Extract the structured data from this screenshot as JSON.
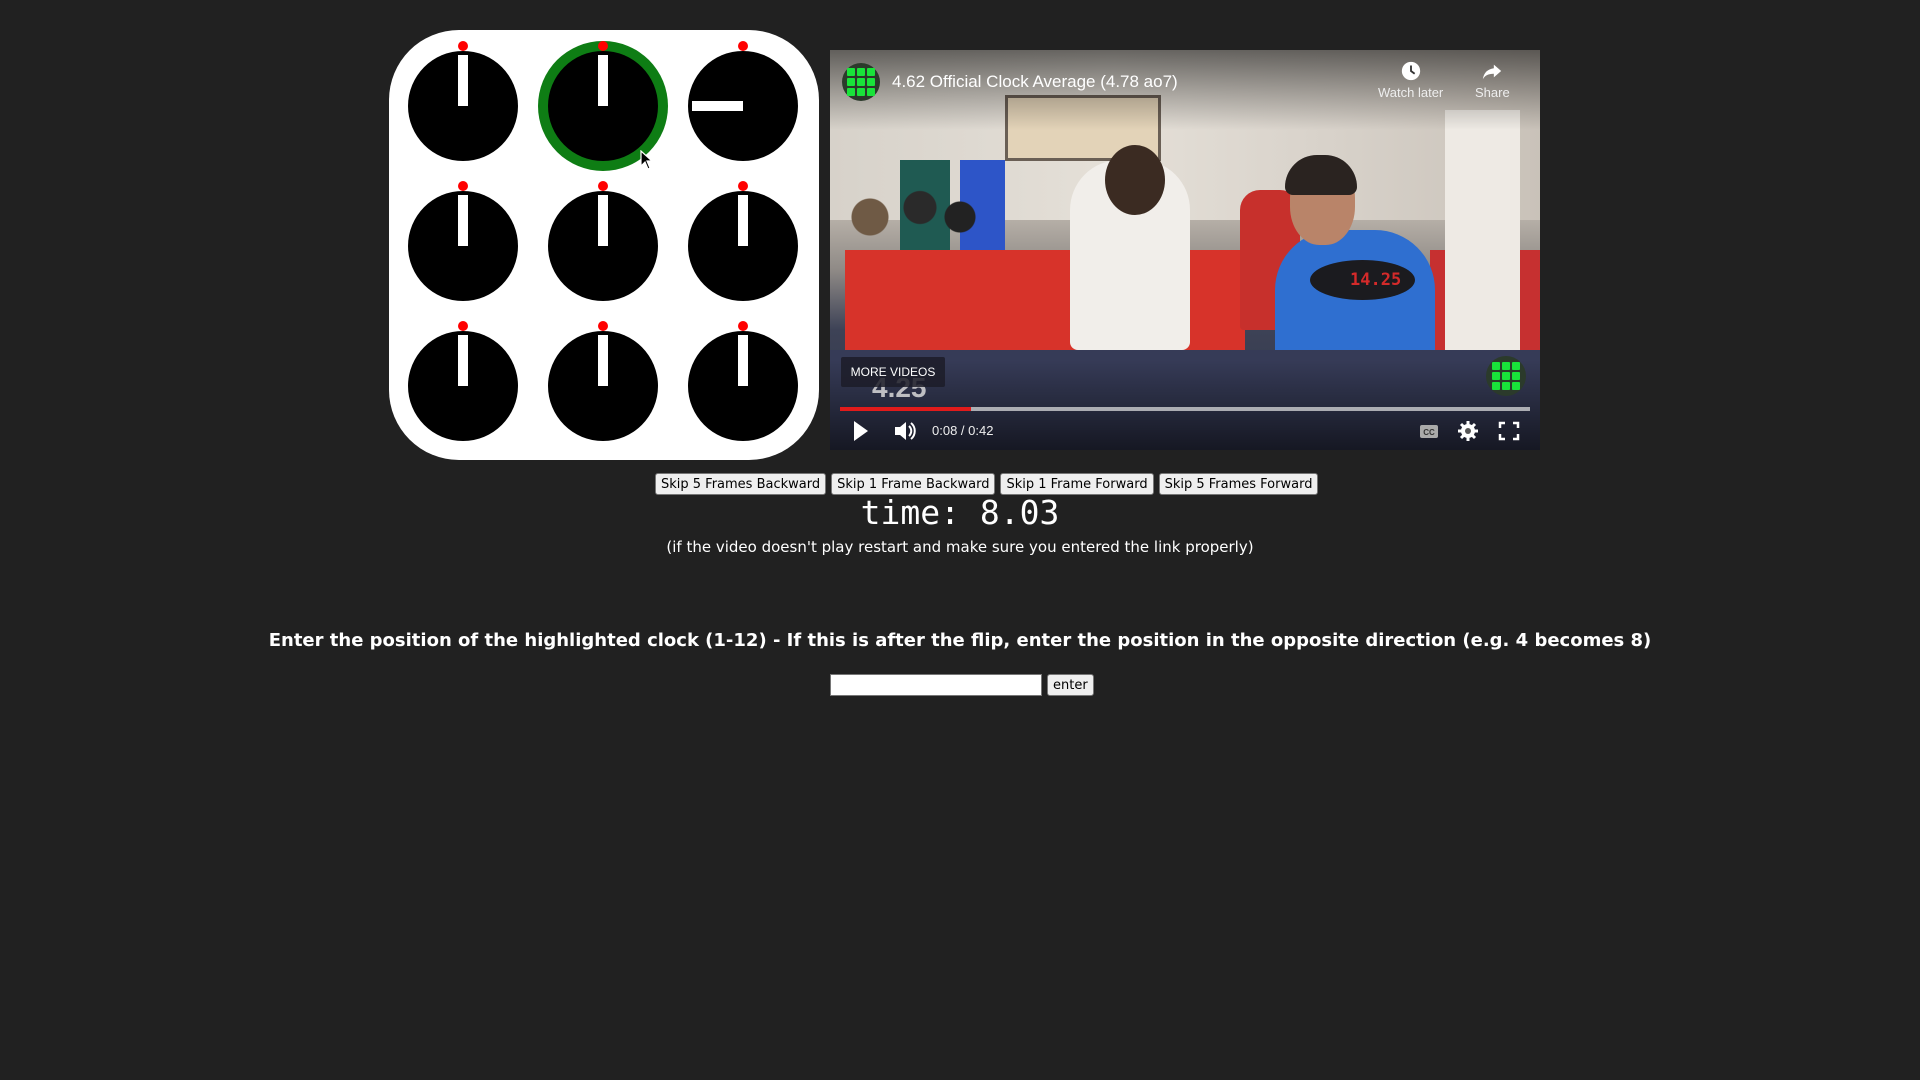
{
  "puzzle": {
    "highlighted_index": 1,
    "clocks": [
      {
        "position": 12,
        "highlighted": false
      },
      {
        "position": 12,
        "highlighted": true
      },
      {
        "position": 9,
        "highlighted": false
      },
      {
        "position": 12,
        "highlighted": false
      },
      {
        "position": 12,
        "highlighted": false
      },
      {
        "position": 12,
        "highlighted": false
      },
      {
        "position": 12,
        "highlighted": false
      },
      {
        "position": 12,
        "highlighted": false
      },
      {
        "position": 12,
        "highlighted": false
      }
    ],
    "colors": {
      "highlight": "#0e7d14",
      "pin": "#ff0000",
      "face": "#000000",
      "hand": "#ffffff"
    }
  },
  "video": {
    "title": "4.62 Official Clock Average (4.78 ao7)",
    "watch_later_label": "Watch later",
    "share_label": "Share",
    "more_videos_label": "MORE VIDEOS",
    "overlay_score": "4.25",
    "timer_digits": "14.25",
    "current_time": "0:08",
    "duration": "0:42",
    "time_readout": "0:08 / 0:42",
    "progress_fraction": 0.19,
    "icons": [
      "play-icon",
      "volume-icon",
      "cc-icon",
      "settings-gear-icon",
      "fullscreen-icon",
      "clock-icon",
      "share-arrow-icon"
    ]
  },
  "frame_controls": {
    "skip5_back": "Skip 5 Frames Backward",
    "skip1_back": "Skip 1 Frame Backward",
    "skip1_fwd": "Skip 1 Frame Forward",
    "skip5_fwd": "Skip 5 Frames Forward"
  },
  "time_display": "time: 8.03",
  "hint": "(if the video doesn't play restart and make sure you entered the link properly)",
  "instructions": "Enter the position of the highlighted clock (1-12) - If this is after the flip, enter the position in the opposite direction (e.g. 4 becomes 8)",
  "answer": {
    "value": "",
    "placeholder": "",
    "submit_label": "enter"
  }
}
